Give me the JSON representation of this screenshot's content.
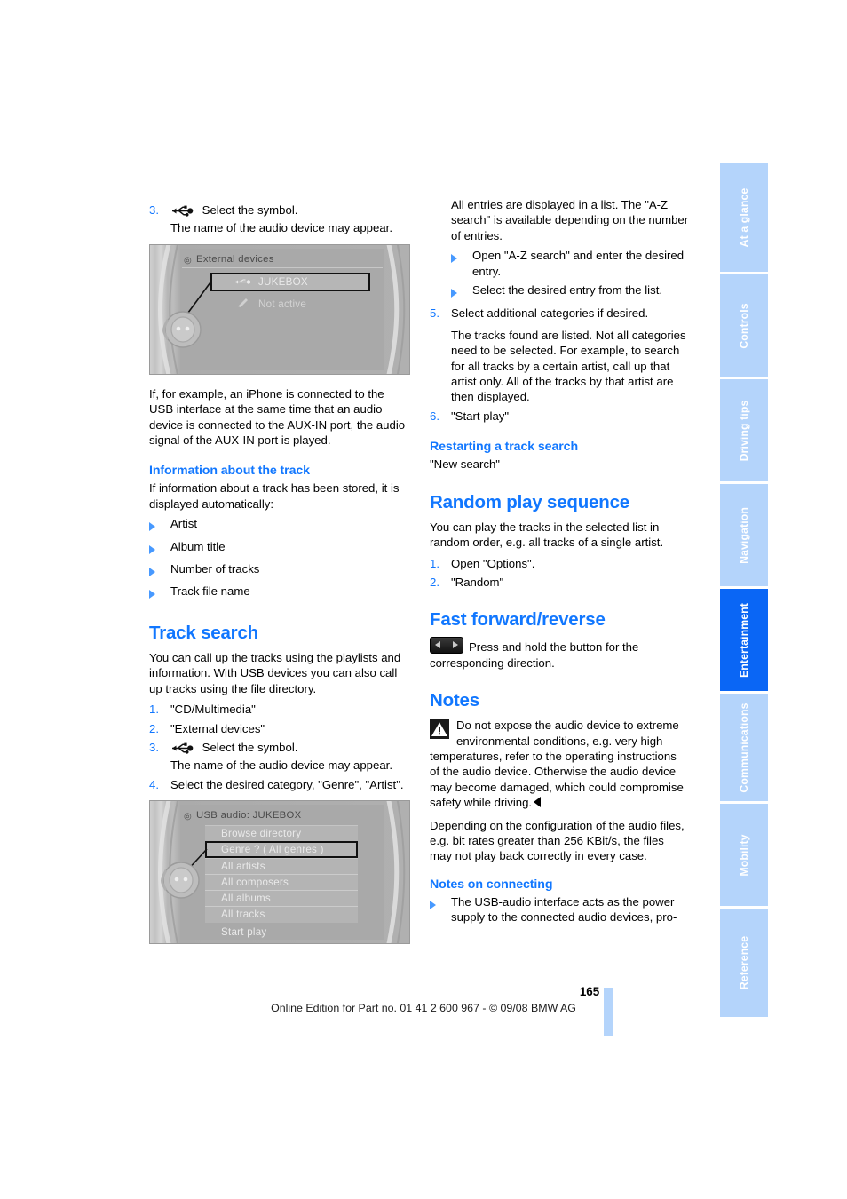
{
  "document": {
    "page_number": "165",
    "footer": "Online Edition for Part no. 01 41 2 600 967  - © 09/08 BMW AG",
    "accent_blue": "#1177ff",
    "tab_blue": "#b4d4fb",
    "tab_active_blue": "#0a66f5"
  },
  "sidebar": {
    "tabs": [
      {
        "label": "At a glance",
        "active": false
      },
      {
        "label": "Controls",
        "active": false
      },
      {
        "label": "Driving tips",
        "active": false
      },
      {
        "label": "Navigation",
        "active": false
      },
      {
        "label": "Entertainment",
        "active": true
      },
      {
        "label": "Communications",
        "active": false
      },
      {
        "label": "Mobility",
        "active": false
      },
      {
        "label": "Reference",
        "active": false
      }
    ]
  },
  "left_column": {
    "step3": {
      "number": "3.",
      "icon": "usb-icon",
      "line1": "Select the symbol.",
      "line2": "The name of the audio device may appear."
    },
    "figure_external_devices": {
      "title": "External devices",
      "title_icon": "multimedia-icon",
      "rows": [
        {
          "icon": "usb-icon",
          "label": "JUKEBOX",
          "selected": true
        },
        {
          "icon": "aux-in-icon",
          "label": "Not active",
          "selected": false
        }
      ]
    },
    "iphone_note": "If, for example, an iPhone is connected to the USB interface at the same time that an audio device is connected to the AUX-IN port, the audio signal of the AUX-IN port is played.",
    "info_track": {
      "heading": "Information about the track",
      "intro": "If information about a track has been stored, it is displayed automatically:",
      "items": [
        "Artist",
        "Album title",
        "Number of tracks",
        "Track file name"
      ]
    },
    "track_search": {
      "heading": "Track search",
      "intro": "You can call up the tracks using the playlists and information. With USB devices you can also call up tracks using the file directory.",
      "steps": [
        {
          "number": "1.",
          "text": "\"CD/Multimedia\""
        },
        {
          "number": "2.",
          "text": "\"External devices\""
        },
        {
          "number": "3.",
          "icon": "usb-icon",
          "text": "Select the symbol.",
          "text2": "The name of the audio device may appear."
        },
        {
          "number": "4.",
          "text": "Select the desired category, \"Genre\", \"Artist\"."
        }
      ]
    },
    "figure_usb_audio": {
      "title": "USB audio: JUKEBOX",
      "title_icon": "multimedia-icon",
      "rows": [
        {
          "label": "Browse directory",
          "selected": false
        },
        {
          "label": "Genre ? ( All genres )",
          "selected": true
        },
        {
          "label": "All artists",
          "selected": false
        },
        {
          "label": "All composers",
          "selected": false
        },
        {
          "label": "All albums",
          "selected": false
        },
        {
          "label": "All tracks",
          "selected": false
        },
        {
          "label": "Start play",
          "selected": false
        }
      ]
    }
  },
  "right_column": {
    "az_intro": "All entries are displayed in a list. The \"A-Z search\" is available depending on the number of entries.",
    "az_bullets": [
      "Open \"A-Z search\" and enter the desired entry.",
      "Select the desired entry from the list."
    ],
    "step5": {
      "number": "5.",
      "text": "Select additional categories if desired."
    },
    "step5_note": "The tracks found are listed. Not all categories need to be selected. For example, to search for all tracks by a certain artist, call up that artist only. All of the tracks by that artist are then displayed.",
    "step6": {
      "number": "6.",
      "text": "\"Start play\""
    },
    "restarting": {
      "heading": "Restarting a track search",
      "text": "\"New search\""
    },
    "random": {
      "heading": "Random play sequence",
      "intro": "You can play the tracks in the selected list in random order, e.g. all tracks of a single artist.",
      "steps": [
        {
          "number": "1.",
          "text": "Open \"Options\"."
        },
        {
          "number": "2.",
          "text": "\"Random\""
        }
      ]
    },
    "fast_forward": {
      "heading": "Fast forward/reverse",
      "icon": "seek-button-icon",
      "text": "Press and hold the button for the corresponding direction."
    },
    "notes": {
      "heading": "Notes",
      "warning_icon": "warning-triangle-icon",
      "warning_text": "Do not expose the audio device to extreme environmental conditions, e.g. very high temperatures, refer to the operating instructions of the audio device. Otherwise the audio device may become damaged, which could compromise safety while driving.",
      "bitrate_text": "Depending on the configuration of the audio files, e.g. bit rates greater than 256 KBit/s, the files may not play back correctly in every case."
    },
    "notes_connecting": {
      "heading": "Notes on connecting",
      "items": [
        "The USB-audio interface acts as the power supply to the connected audio devices, pro-"
      ]
    }
  }
}
